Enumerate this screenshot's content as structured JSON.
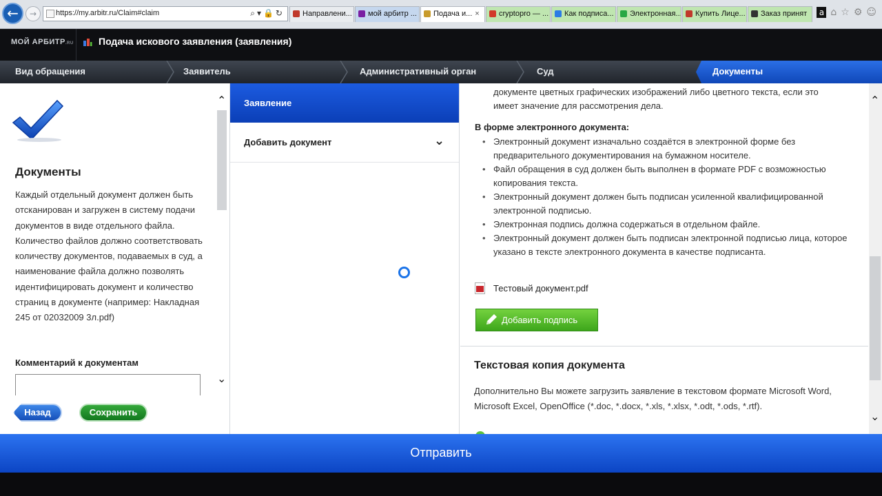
{
  "browser": {
    "url": "https://my.arbitr.ru/Claim#claim",
    "tabs": [
      {
        "label": "Направлени...",
        "color": "#c0392b"
      },
      {
        "label": "мой арбитр ...",
        "color": "#7a1fa2"
      },
      {
        "label": "Подача и...",
        "color": "#c89b2c",
        "active": true
      },
      {
        "label": "cryptopro — ...",
        "color": "#d23a2a"
      },
      {
        "label": "Как подписа...",
        "color": "#2c7be5"
      },
      {
        "label": "Электронная...",
        "color": "#27a844"
      },
      {
        "label": "Купить Лице...",
        "color": "#c0392b"
      },
      {
        "label": "Заказ принят",
        "color": "#333333"
      }
    ],
    "close_glyph": "×"
  },
  "header": {
    "logo": "МОЙ АРБИТР",
    "logo_suffix": ".RU",
    "title": "Подача искового заявления (заявления)"
  },
  "steps": [
    {
      "label": "Вид обращения"
    },
    {
      "label": "Заявитель"
    },
    {
      "label": "Административный орган"
    },
    {
      "label": "Суд"
    },
    {
      "label": "Документы",
      "active": true
    }
  ],
  "left": {
    "title": "Документы",
    "text": "Каждый отдельный документ должен быть отсканирован и загружен в систему подачи документов в виде отдельного файла. Количество файлов должно соответствовать количеству документов, подаваемых в суд, а наименование файла должно позволять идентифицировать документ и количество страниц в документе (например: Накладная 245 от 02032009 3л.pdf)",
    "comment_label": "Комментарий к документам",
    "back_label": "Назад",
    "save_label": "Сохранить"
  },
  "middle": {
    "active_item": "Заявление",
    "add_item": "Добавить документ"
  },
  "right": {
    "top_text_line1": "документе цветных графических изображений либо цветного текста, если это",
    "top_text_line2": "имеет значение для рассмотрения дела.",
    "section_title": "В форме электронного документа:",
    "bullets": [
      "Электронный документ изначально создаётся в электронной форме без предварительного документирования на бумажном носителе.",
      "Файл обращения в суд должен быть выполнен в формате PDF с возможностью копирования текста.",
      "Электронный документ должен быть подписан усиленной квалифицированной электронной подписью.",
      "Электронная подпись должна содержаться в отдельном файле.",
      "Электронный документ должен быть подписан электронной подписью лица, которое указано в тексте электронного документа в качестве подписанта."
    ],
    "file_name": "Тестовый документ.pdf",
    "sign_button": "Добавить подпись",
    "text_copy_title": "Текстовая копия документа",
    "text_copy_line1": "Дополнительно Вы можете загрузить заявление в текстовом формате Microsoft Word,",
    "text_copy_line2": "Microsoft Excel, OpenOffice (*.doc, *.docx, *.xls, *.xlsx, *.odt, *.ods, *.rtf)."
  },
  "footer": {
    "submit_label": "Отправить"
  }
}
